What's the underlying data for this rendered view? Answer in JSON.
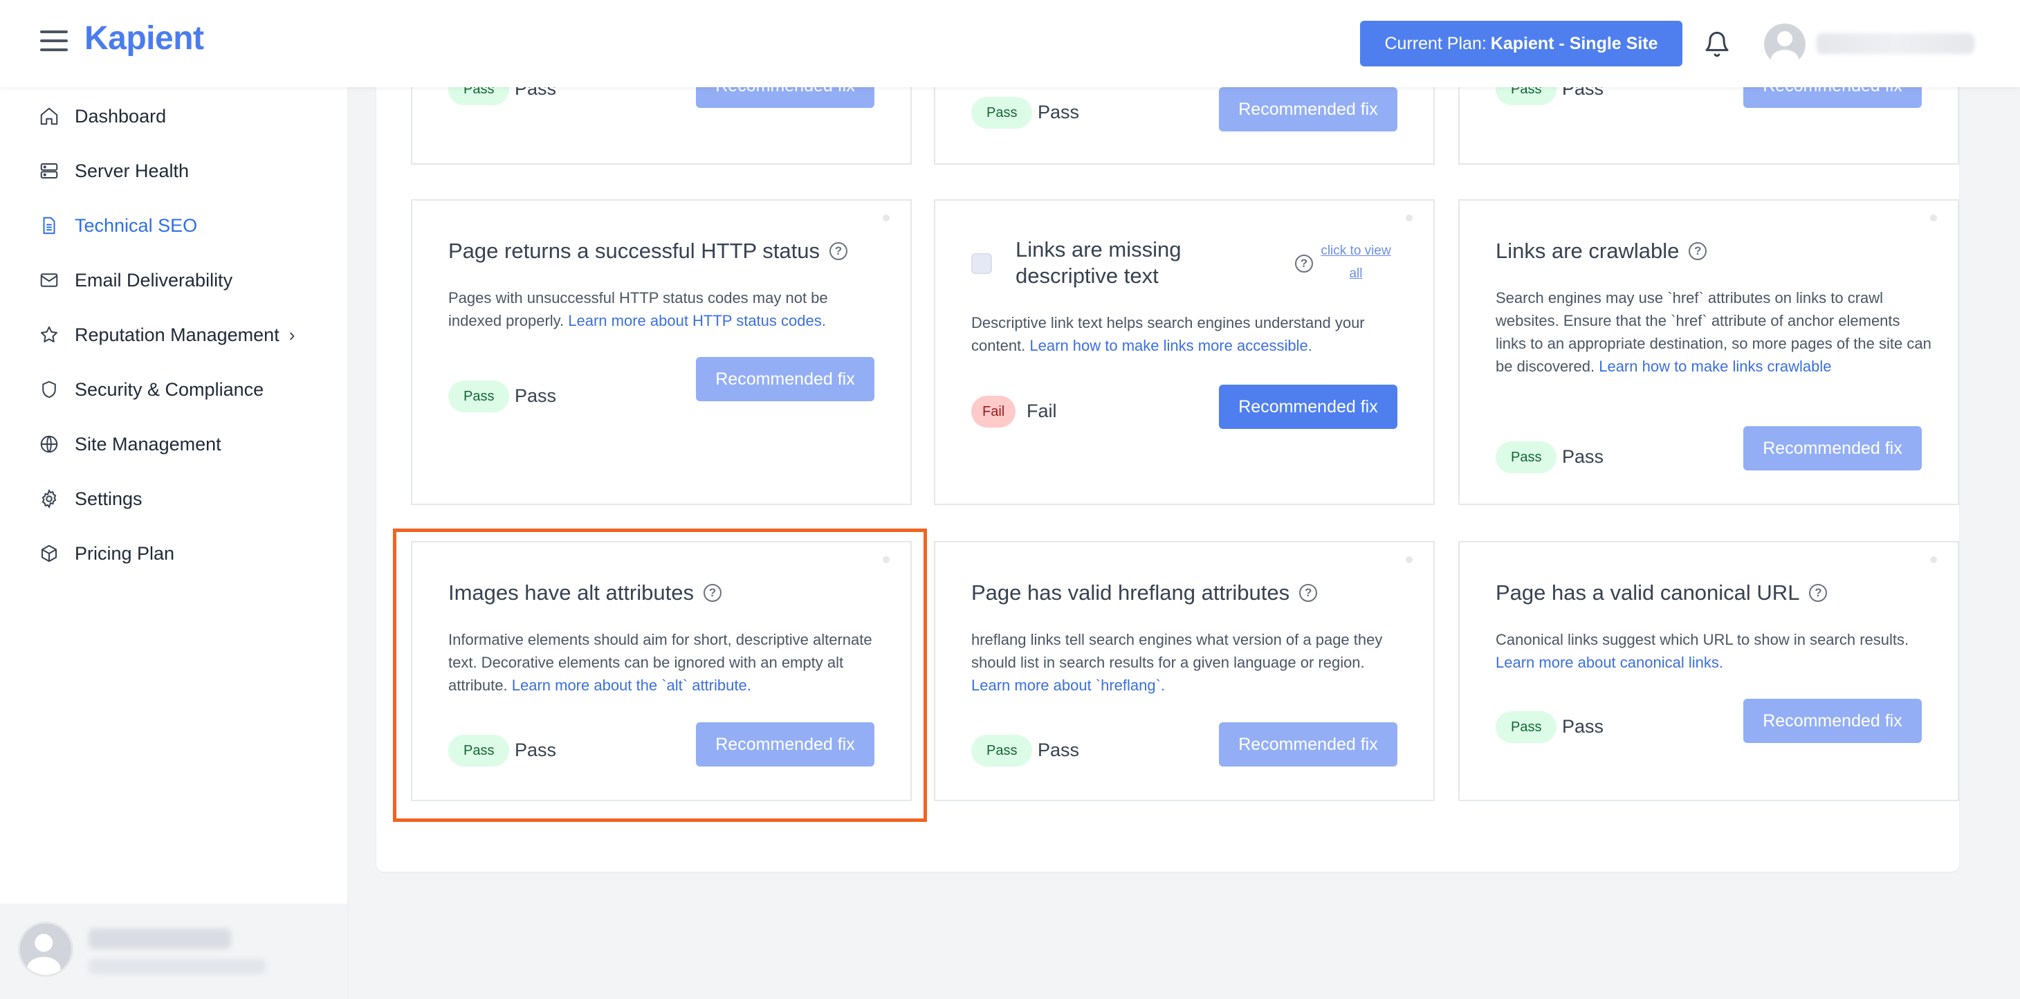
{
  "header": {
    "logo": "Kapient",
    "plan_prefix": "Current Plan:",
    "plan_name": "Kapient - Single Site"
  },
  "sidebar": {
    "items": [
      {
        "label": "Dashboard",
        "icon": "home-icon"
      },
      {
        "label": "Server Health",
        "icon": "server-icon"
      },
      {
        "label": "Technical SEO",
        "icon": "document-icon",
        "active": true
      },
      {
        "label": "Email Deliverability",
        "icon": "mail-icon"
      },
      {
        "label": "Reputation Management",
        "icon": "star-icon",
        "has_submenu": true
      },
      {
        "label": "Security & Compliance",
        "icon": "shield-icon"
      },
      {
        "label": "Site Management",
        "icon": "globe-icon"
      },
      {
        "label": "Settings",
        "icon": "gear-icon"
      },
      {
        "label": "Pricing Plan",
        "icon": "cube-icon"
      }
    ],
    "chevron": "›"
  },
  "common": {
    "fix_label": "Recommended fix",
    "pass_badge": "Pass",
    "pass_text": "Pass",
    "fail_badge": "Fail",
    "fail_text": "Fail",
    "help_glyph": "?"
  },
  "cards": [
    {
      "title": "",
      "status": "pass"
    },
    {
      "title": "",
      "status": "pass"
    },
    {
      "title": "",
      "status": "pass"
    },
    {
      "title": "Page returns a successful HTTP status",
      "desc": "Pages with unsuccessful HTTP status codes may not be indexed properly.",
      "link": "Learn more about HTTP status codes.",
      "status": "pass"
    },
    {
      "title": "Links are missing descriptive text",
      "desc": "Descriptive link text helps search engines understand your content.",
      "link": "Learn how to make links more accessible.",
      "view_all": "click to view all",
      "status": "fail"
    },
    {
      "title": "Links are crawlable",
      "desc": "Search engines may use `href` attributes on links to crawl websites. Ensure that the `href` attribute of anchor elements links to an appropriate destination, so more pages of the site can be discovered.",
      "link": "Learn how to make links crawlable",
      "status": "pass"
    },
    {
      "title": "Images have alt attributes",
      "desc": "Informative elements should aim for short, descriptive alternate text. Decorative elements can be ignored with an empty alt attribute.",
      "link": "Learn more about the `alt` attribute.",
      "status": "pass"
    },
    {
      "title": "Page has valid hreflang attributes",
      "desc": "hreflang links tell search engines what version of a page they should list in search results for a given language or region.",
      "link": "Learn more about `hreflang`.",
      "status": "pass"
    },
    {
      "title": "Page has a valid canonical URL",
      "desc": "Canonical links suggest which URL to show in search results.",
      "link": "Learn more about canonical links.",
      "status": "pass"
    }
  ],
  "colors": {
    "accent": "#4f7fef",
    "accent_light": "#93aef5",
    "highlight": "#f26322",
    "pass_bg": "#dcfce7",
    "fail_bg": "#fecaca"
  }
}
